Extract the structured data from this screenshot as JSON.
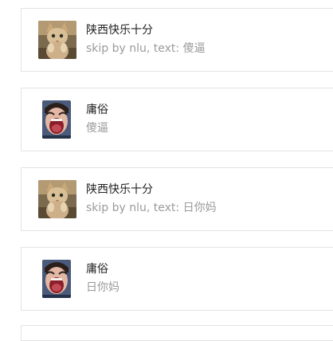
{
  "messages": [
    {
      "sender": "陕西快乐十分",
      "text": "skip by nlu, text: 傻逼",
      "avatar": "cat-photo-avatar"
    },
    {
      "sender": "庸俗",
      "text": "傻逼",
      "avatar": "screaming-face-avatar"
    },
    {
      "sender": "陕西快乐十分",
      "text": "skip by nlu, text: 日你妈",
      "avatar": "cat-photo-avatar"
    },
    {
      "sender": "庸俗",
      "text": "日你妈",
      "avatar": "screaming-face-avatar"
    }
  ]
}
